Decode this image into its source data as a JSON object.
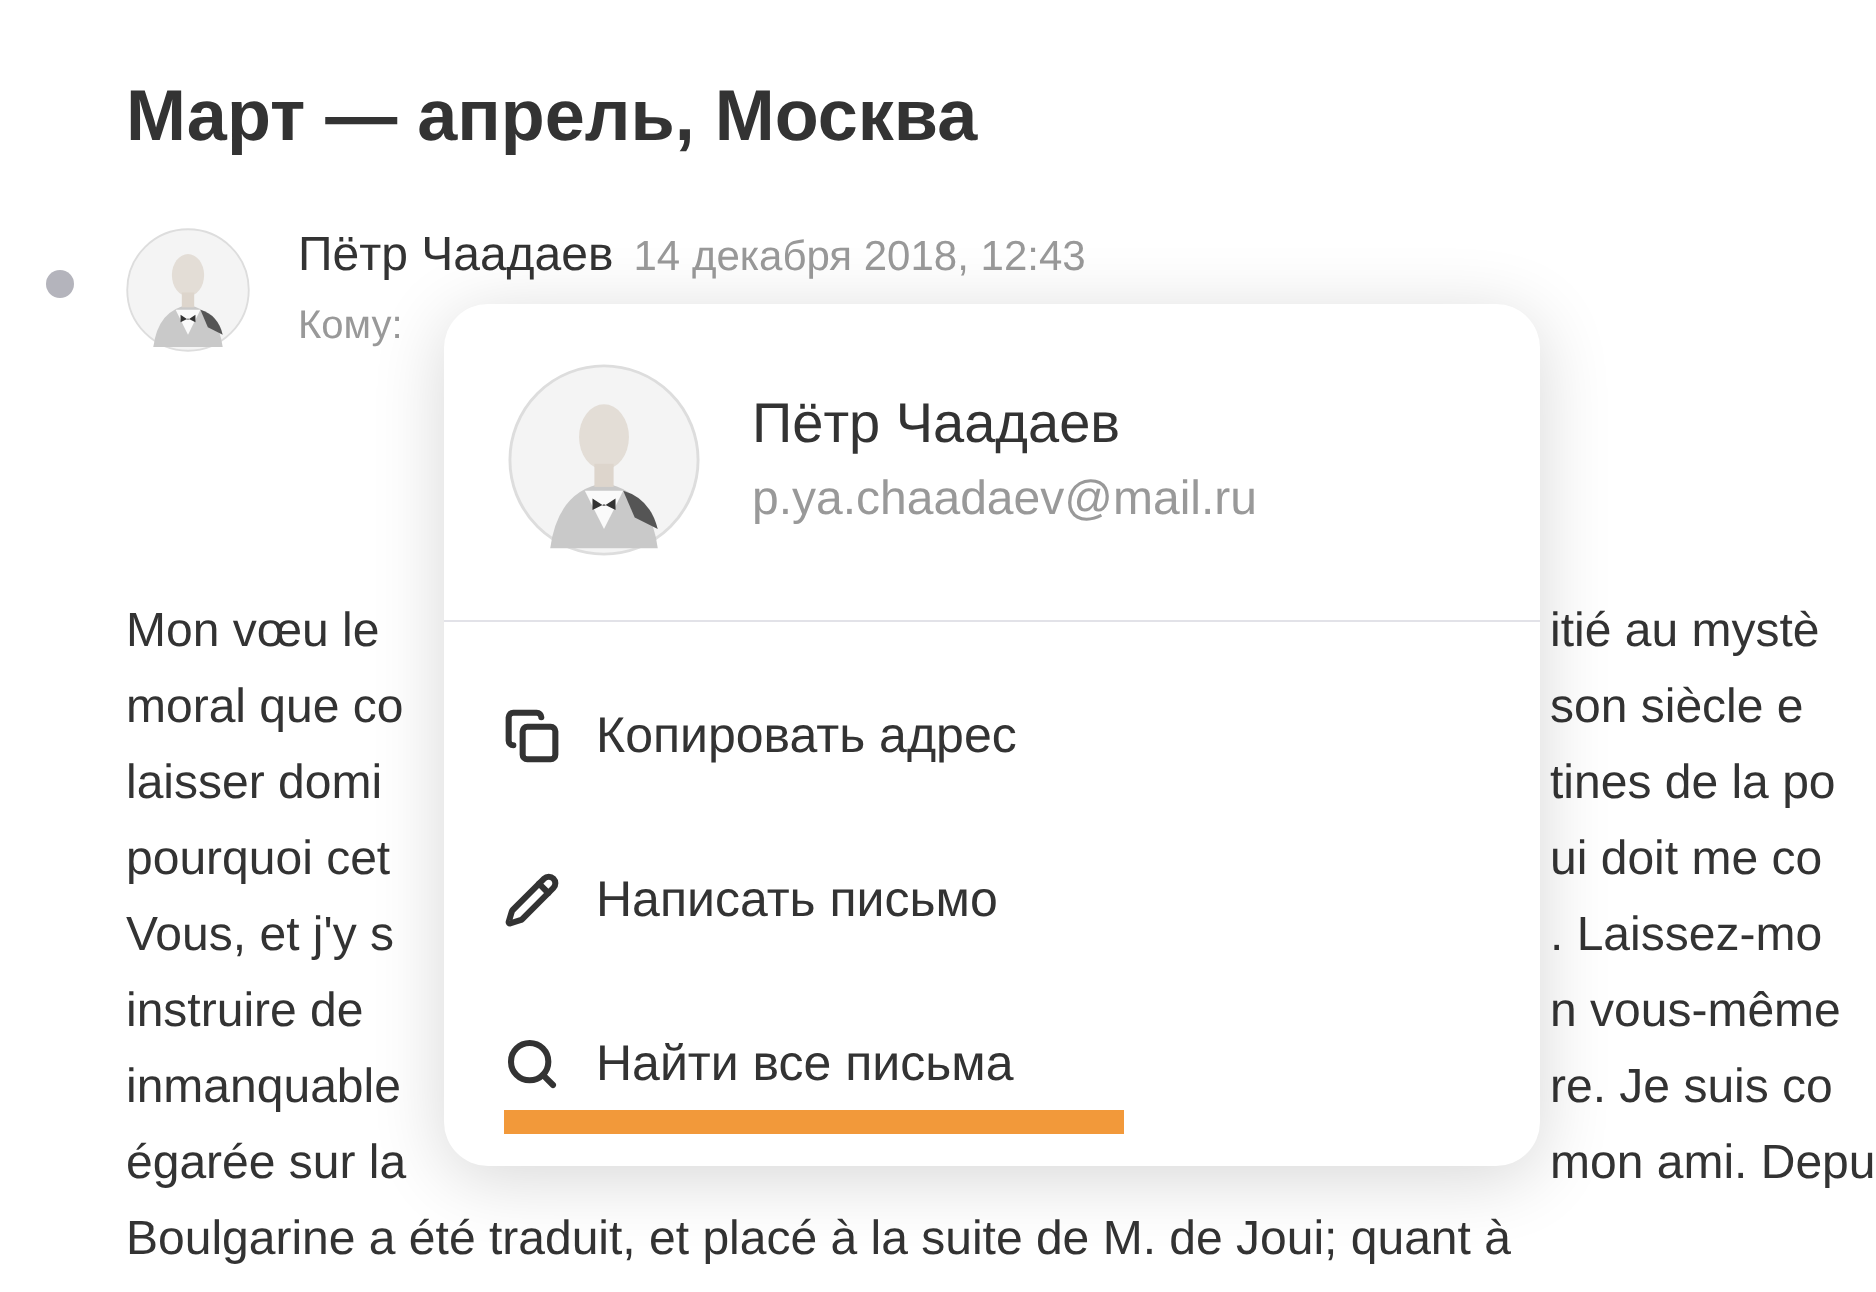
{
  "title": "Март — апрель, Москва",
  "message": {
    "unread": true,
    "sender": "Пётр Чаадаев",
    "date": "14 декабря 2018, 12:43",
    "to_label": "Кому:",
    "body_lines": [
      {
        "left": "Mon vœu le",
        "right": "itié au mystè"
      },
      {
        "left": "moral que co",
        "right": "son siècle e"
      },
      {
        "left": "laisser domi",
        "right": "tines de la po"
      },
      {
        "left": "pourquoi cet",
        "right": "ui doit me co"
      },
      {
        "left": "Vous, et j'y s",
        "right": ". Laissez-mo"
      },
      {
        "left": "instruire de",
        "right": "n vous-même"
      },
      {
        "left": "inmanquable",
        "right": "re. Je suis co"
      },
      {
        "left": "égarée sur la",
        "right": "mon ami. Depu"
      },
      {
        "left": "Boulgarine a été traduit, et placé à la suite de M. de Joui; quant à"
      }
    ]
  },
  "contact_popup": {
    "name": "Пётр Чаадаев",
    "email": "p.ya.chaadaev@mail.ru",
    "items": [
      {
        "kind": "copy",
        "label": "Копировать адрес",
        "selected": false
      },
      {
        "kind": "write",
        "label": "Написать письмо",
        "selected": false
      },
      {
        "kind": "search",
        "label": "Найти все письма",
        "selected": true
      }
    ]
  }
}
